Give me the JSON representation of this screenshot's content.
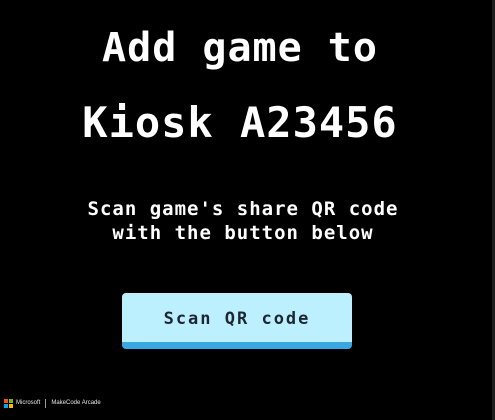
{
  "heading": {
    "line1": "Add game to",
    "line2": "Kiosk A23456"
  },
  "instructions": {
    "line1": "Scan game's share QR code",
    "line2": "with the button below"
  },
  "scan_button": {
    "label": "Scan QR code"
  },
  "footer": {
    "microsoft_label": "Microsoft",
    "product_label": "MakeCode Arcade",
    "logo_icon": "microsoft-logo-icon"
  },
  "colors": {
    "background": "#000000",
    "text": "#ffffff",
    "button_face": "#bdf0ff",
    "button_shadow": "#3aa8e0",
    "button_text": "#1d2733",
    "ms_red": "#f25022",
    "ms_green": "#7fba00",
    "ms_blue": "#00a4ef",
    "ms_yellow": "#ffb900"
  }
}
